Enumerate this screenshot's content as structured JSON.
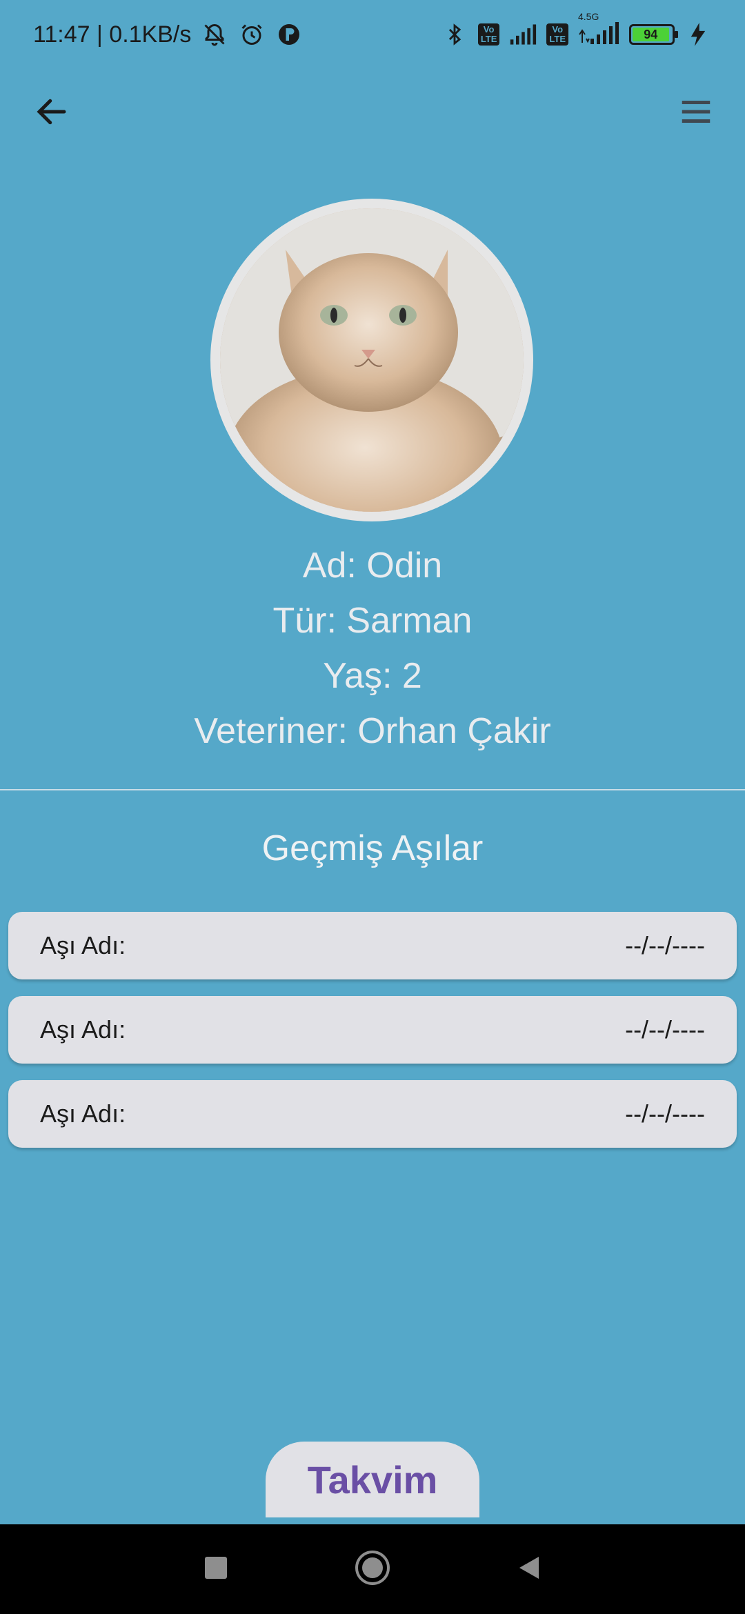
{
  "status_bar": {
    "time_speed": "11:47 | 0.1KB/s",
    "network_badge_1": "Vo\nLTE",
    "network_badge_2": "Vo\nLTE",
    "network_label_2": "4.5G",
    "battery_level": "94"
  },
  "pet": {
    "name_line": "Ad: Odin",
    "type_line": "Tür: Sarman",
    "age_line": "Yaş: 2",
    "vet_line": "Veteriner: Orhan Çakir"
  },
  "vaccines": {
    "title": "Geçmiş Aşılar",
    "rows": [
      {
        "label": "Aşı Adı:",
        "date": "--/--/----"
      },
      {
        "label": "Aşı Adı:",
        "date": "--/--/----"
      },
      {
        "label": "Aşı Adı:",
        "date": "--/--/----"
      }
    ]
  },
  "calendar_button": {
    "label": "Takvim"
  },
  "colors": {
    "background": "#55a8c9",
    "card": "#e1e1e6",
    "accent": "#6a4fa5"
  },
  "icons": {
    "back": "arrow-left-icon",
    "menu": "hamburger-menu-icon",
    "nav_recents": "square-icon",
    "nav_home": "circle-icon",
    "nav_back": "triangle-left-icon"
  }
}
